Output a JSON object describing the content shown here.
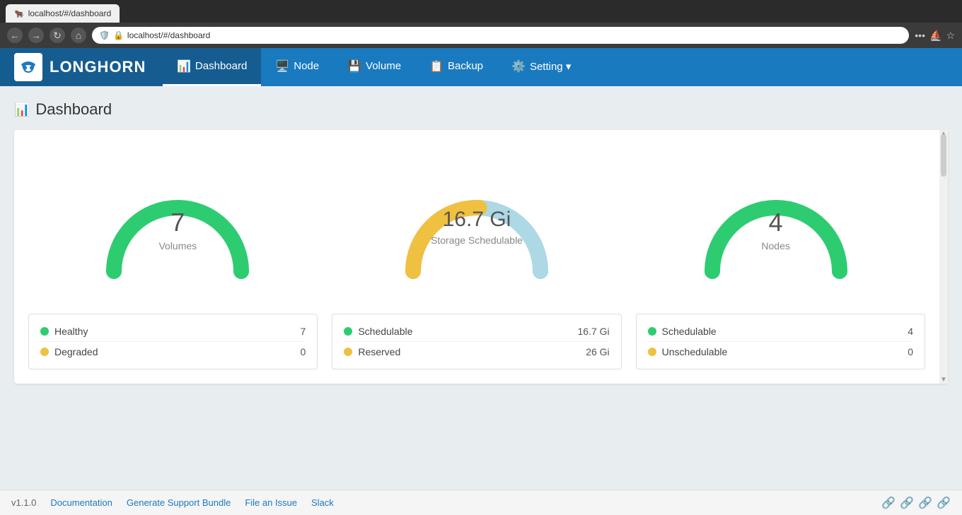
{
  "browser": {
    "url": "localhost/#/dashboard",
    "tab_title": "localhost/#/dashboard"
  },
  "header": {
    "brand_name": "LONGHORN",
    "nav_items": [
      {
        "label": "Dashboard",
        "icon": "📊",
        "active": true
      },
      {
        "label": "Node",
        "icon": "🖥️",
        "active": false
      },
      {
        "label": "Volume",
        "icon": "💾",
        "active": false
      },
      {
        "label": "Backup",
        "icon": "📋",
        "active": false
      },
      {
        "label": "Setting ▾",
        "icon": "⚙️",
        "active": false
      }
    ]
  },
  "page": {
    "title": "Dashboard"
  },
  "gauges": [
    {
      "id": "volumes",
      "value": "7",
      "label": "Volumes",
      "color": "#2ecc71",
      "type": "solid"
    },
    {
      "id": "storage",
      "value": "16.7 Gi",
      "label": "Storage Schedulable",
      "colors": [
        "#f0c040",
        "#add8e6"
      ],
      "type": "split"
    },
    {
      "id": "nodes",
      "value": "4",
      "label": "Nodes",
      "color": "#2ecc71",
      "type": "solid"
    }
  ],
  "stats": [
    {
      "id": "volumes-stats",
      "items": [
        {
          "name": "Healthy",
          "value": "7",
          "dot": "green"
        },
        {
          "name": "Degraded",
          "value": "0",
          "dot": "yellow"
        }
      ]
    },
    {
      "id": "storage-stats",
      "items": [
        {
          "name": "Schedulable",
          "value": "16.7 Gi",
          "dot": "green"
        },
        {
          "name": "Reserved",
          "value": "26 Gi",
          "dot": "yellow"
        }
      ]
    },
    {
      "id": "nodes-stats",
      "items": [
        {
          "name": "Schedulable",
          "value": "4",
          "dot": "green"
        },
        {
          "name": "Unschedulable",
          "value": "0",
          "dot": "yellow"
        }
      ]
    }
  ],
  "footer": {
    "version": "v1.1.0",
    "links": [
      {
        "label": "Documentation"
      },
      {
        "label": "Generate Support Bundle"
      },
      {
        "label": "File an Issue"
      },
      {
        "label": "Slack"
      }
    ]
  }
}
